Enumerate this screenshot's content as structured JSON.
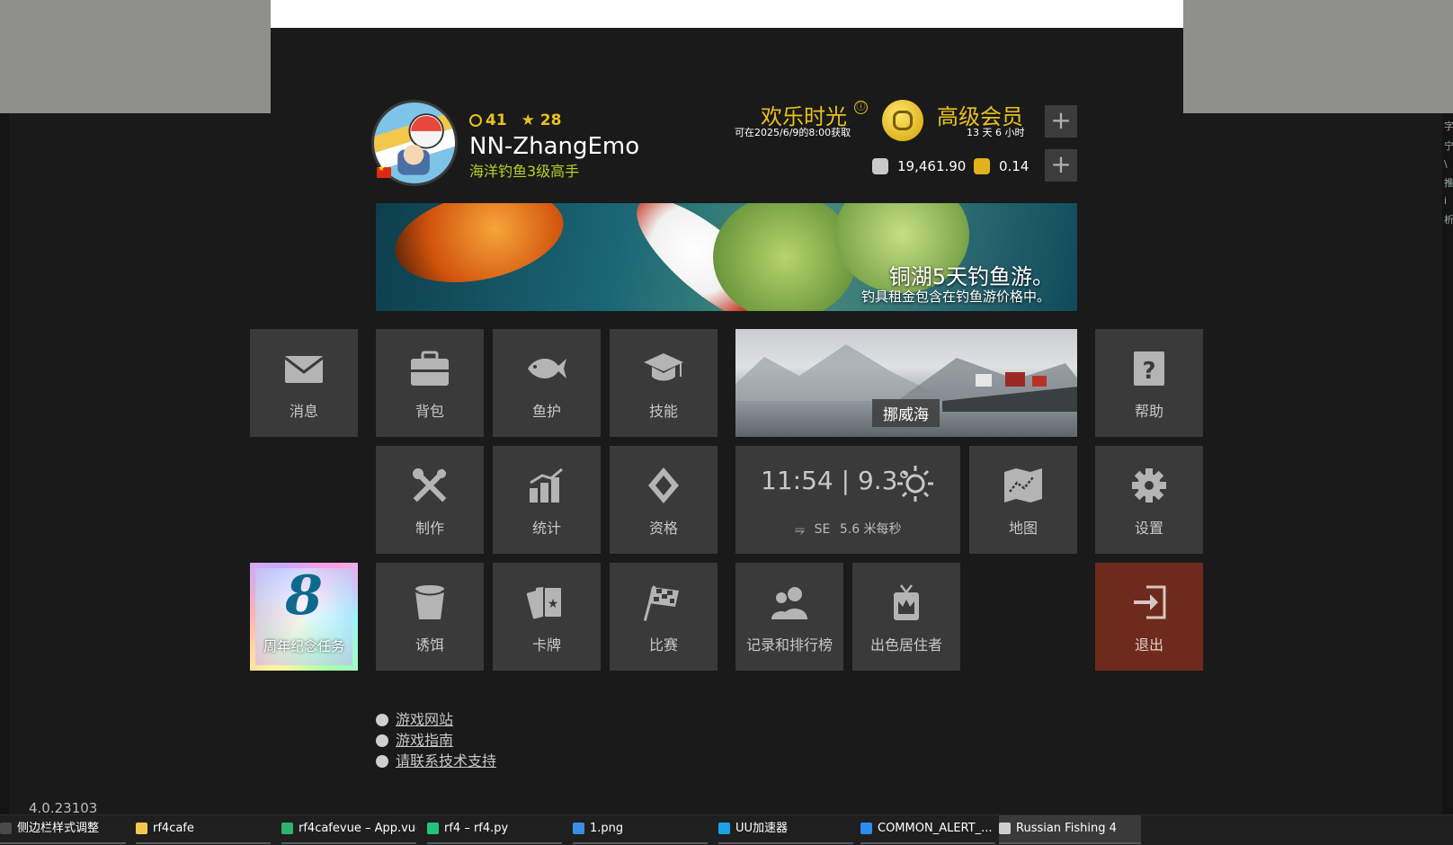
{
  "profile": {
    "rank": "41",
    "stars": "28",
    "name": "NN-ZhangEmo",
    "title": "海洋钓鱼3级高手"
  },
  "happy_hour": {
    "title": "欢乐时光",
    "info_icon": "ⓘ",
    "subtitle": "可在2025/6/9的8:00获取"
  },
  "premium": {
    "title": "高级会员",
    "remaining": "13 天 6 小时"
  },
  "currency": {
    "silver": "19,461.90",
    "gold": "0.14"
  },
  "plus_label": "+",
  "banner": {
    "headline": "铜湖5天钓鱼游。",
    "subtext": "钓具租金包含在钓鱼游价格中。"
  },
  "tiles": {
    "messages": "消息",
    "backpack": "背包",
    "fish_keep": "鱼护",
    "skills": "技能",
    "help": "帮助",
    "crafting": "制作",
    "stats": "统计",
    "licenses": "资格",
    "map": "地图",
    "settings": "设置",
    "anniversary_num": "8",
    "anniversary": "周年纪念任务",
    "bait": "诱饵",
    "cards": "卡牌",
    "competitions": "比赛",
    "records": "记录和排行榜",
    "residents": "出色居住者",
    "exit": "退出"
  },
  "location": {
    "name": "挪威海"
  },
  "weather": {
    "time": "11:54",
    "separator": "|",
    "temperature": "9.3°",
    "wind_dir": "SE",
    "wind_speed": "5.6 米每秒"
  },
  "links": [
    "游戏网站",
    "游戏指南",
    "请联系技术支持"
  ],
  "version": "4.0.23103",
  "right_edge_text": [
    "字",
    "宁",
    "\\",
    "推",
    "i",
    "析"
  ],
  "taskbar": [
    {
      "label": "侧边栏样式调整",
      "icon_color": "#4a4a4a"
    },
    {
      "label": "rf4cafe",
      "icon_color": "#f2c94c"
    },
    {
      "label": "rf4cafevue – App.vue",
      "icon_color": "#2fb36b"
    },
    {
      "label": "rf4 – rf4.py",
      "icon_color": "#21c47a"
    },
    {
      "label": "1.png",
      "icon_color": "#3a8ee6"
    },
    {
      "label": "UU加速器",
      "icon_color": "#1aa3e8"
    },
    {
      "label": "COMMON_ALERT_...",
      "icon_color": "#2d8cf0"
    },
    {
      "label": "Russian Fishing 4",
      "icon_color": "#cfcfcf"
    }
  ]
}
